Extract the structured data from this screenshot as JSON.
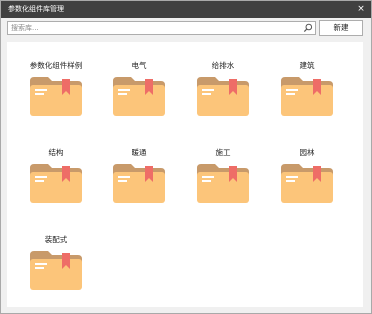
{
  "window": {
    "title": "参数化组件库管理",
    "close_symbol": "×"
  },
  "search": {
    "placeholder": "搜索库...",
    "value": "",
    "icon": "search-icon"
  },
  "toolbar": {
    "new_label": "新建"
  },
  "library": {
    "items": [
      {
        "label": "参数化组件样例",
        "icon": "folder-icon"
      },
      {
        "label": "电气",
        "icon": "folder-icon"
      },
      {
        "label": "给排水",
        "icon": "folder-icon"
      },
      {
        "label": "建筑",
        "icon": "folder-icon"
      },
      {
        "label": "结构",
        "icon": "folder-icon"
      },
      {
        "label": "暖通",
        "icon": "folder-icon"
      },
      {
        "label": "施工",
        "icon": "folder-icon"
      },
      {
        "label": "园林",
        "icon": "folder-icon"
      },
      {
        "label": "装配式",
        "icon": "folder-icon"
      }
    ]
  },
  "colors": {
    "titlebar": "#404040",
    "folder_front": "#fcc57a",
    "folder_back": "#c89a6a",
    "bookmark": "#ee6d67",
    "folder_lines": "#ffffff"
  }
}
